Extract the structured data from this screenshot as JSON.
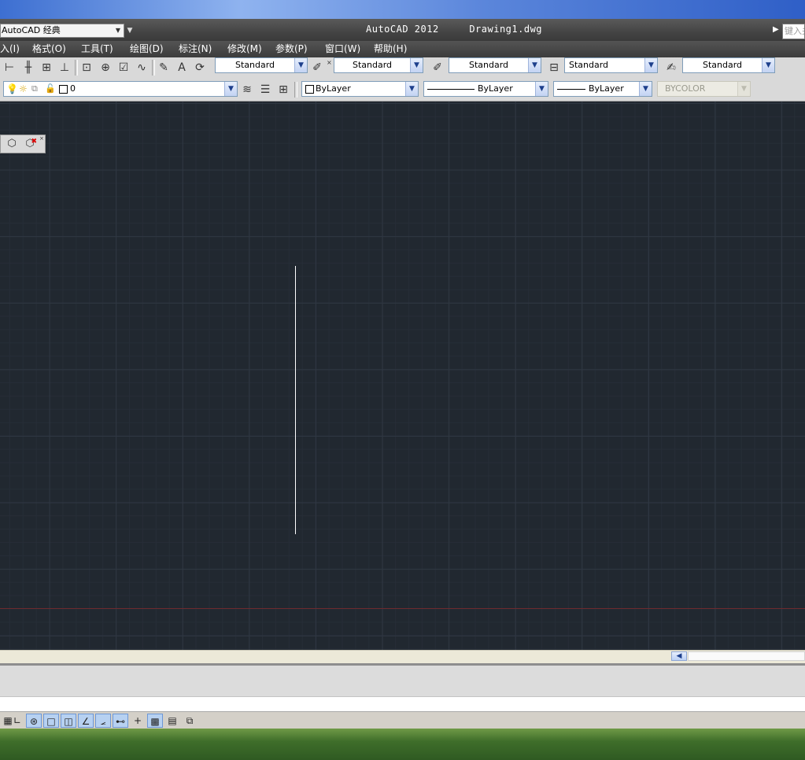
{
  "title_bar": {
    "workspace": "AutoCAD 经典",
    "app_title": "AutoCAD 2012",
    "file_name": "Drawing1.dwg",
    "search_placeholder": "键入关"
  },
  "menu": [
    {
      "label": "入(I)"
    },
    {
      "label": "格式(O)"
    },
    {
      "label": "工具(T)"
    },
    {
      "label": "绘图(D)"
    },
    {
      "label": "标注(N)"
    },
    {
      "label": "修改(M)"
    },
    {
      "label": "参数(P)"
    },
    {
      "label": "窗口(W)"
    },
    {
      "label": "帮助(H)"
    }
  ],
  "styles_toolbar": {
    "dim_style": "Standard",
    "text_style": "Standard",
    "dim_style2": "Standard",
    "table_style": "Standard",
    "multileader_style": "Standard"
  },
  "layers_toolbar": {
    "current_layer": "0"
  },
  "properties_toolbar": {
    "color": "ByLayer",
    "linetype": "ByLayer",
    "lineweight": "ByLayer",
    "plot_style": "BYCOLOR"
  },
  "icons": {
    "close": "×",
    "scroll_left": "◀",
    "dropdown": "▼"
  }
}
